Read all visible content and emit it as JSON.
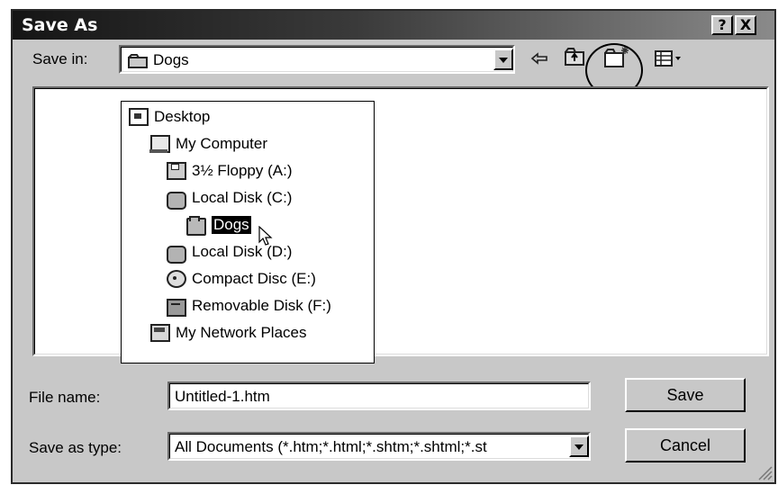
{
  "window": {
    "title": "Save As",
    "help_label": "?",
    "close_label": "X"
  },
  "save_in": {
    "label": "Save in:",
    "value": "Dogs",
    "value_icon": "folder-icon"
  },
  "toolbar": {
    "back_icon": "back-arrow-icon",
    "up_icon": "up-one-level-icon",
    "new_folder_icon": "create-new-folder-icon",
    "view_menu_icon": "view-menu-icon",
    "highlight": "circle around create-new-folder button"
  },
  "location_list": [
    {
      "label": "Desktop",
      "icon": "desktop-icon",
      "level": 0
    },
    {
      "label": "My Computer",
      "icon": "my-computer-icon",
      "level": 1
    },
    {
      "label": "3½ Floppy (A:)",
      "icon": "floppy-drive-icon",
      "level": 2
    },
    {
      "label": "Local Disk (C:)",
      "icon": "hard-disk-icon",
      "level": 2
    },
    {
      "label": "Dogs",
      "icon": "folder-icon",
      "level": 3,
      "selected": true
    },
    {
      "label": "Local Disk (D:)",
      "icon": "hard-disk-icon",
      "level": 2
    },
    {
      "label": "Compact Disc (E:)",
      "icon": "cd-drive-icon",
      "level": 2
    },
    {
      "label": "Removable Disk (F:)",
      "icon": "removable-disk-icon",
      "level": 2
    },
    {
      "label": "My Network Places",
      "icon": "network-places-icon",
      "level": 1
    }
  ],
  "file_name": {
    "label": "File name:",
    "value": "Untitled-1.htm"
  },
  "save_as_type": {
    "label": "Save as type:",
    "value": "All Documents (*.htm;*.html;*.shtm;*.shtml;*.st"
  },
  "buttons": {
    "save": "Save",
    "cancel": "Cancel"
  }
}
